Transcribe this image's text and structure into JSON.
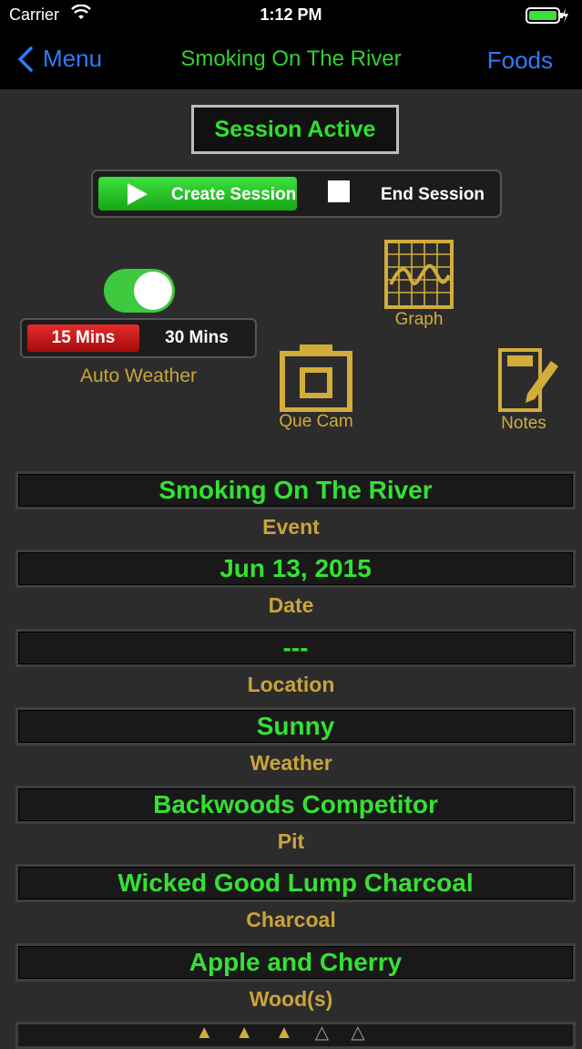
{
  "status_bar": {
    "carrier": "Carrier",
    "time": "1:12 PM"
  },
  "nav": {
    "back_label": "Menu",
    "title": "Smoking On The River",
    "right_label": "Foods"
  },
  "session": {
    "status": "Session Active",
    "create_label": "Create Session",
    "end_label": "End Session"
  },
  "weather_controls": {
    "min15": "15 Mins",
    "min30": "30 Mins",
    "auto_weather_label": "Auto Weather",
    "auto_weather_on": true
  },
  "tools": {
    "graph_label": "Graph",
    "cam_label": "Que Cam",
    "notes_label": "Notes"
  },
  "fields": [
    {
      "value": "Smoking On The River",
      "label": "Event"
    },
    {
      "value": "Jun 13, 2015",
      "label": "Date"
    },
    {
      "value": "---",
      "label": "Location"
    },
    {
      "value": "Sunny",
      "label": "Weather"
    },
    {
      "value": "Backwoods Competitor",
      "label": "Pit"
    },
    {
      "value": "Wicked Good Lump Charcoal",
      "label": "Charcoal"
    },
    {
      "value": "Apple and Cherry",
      "label": "Wood(s)"
    }
  ],
  "rating": {
    "filled": 3,
    "total": 5
  },
  "colors": {
    "accent_green": "#35e035",
    "gold": "#c9a43a",
    "link_blue": "#2d7cf6"
  }
}
